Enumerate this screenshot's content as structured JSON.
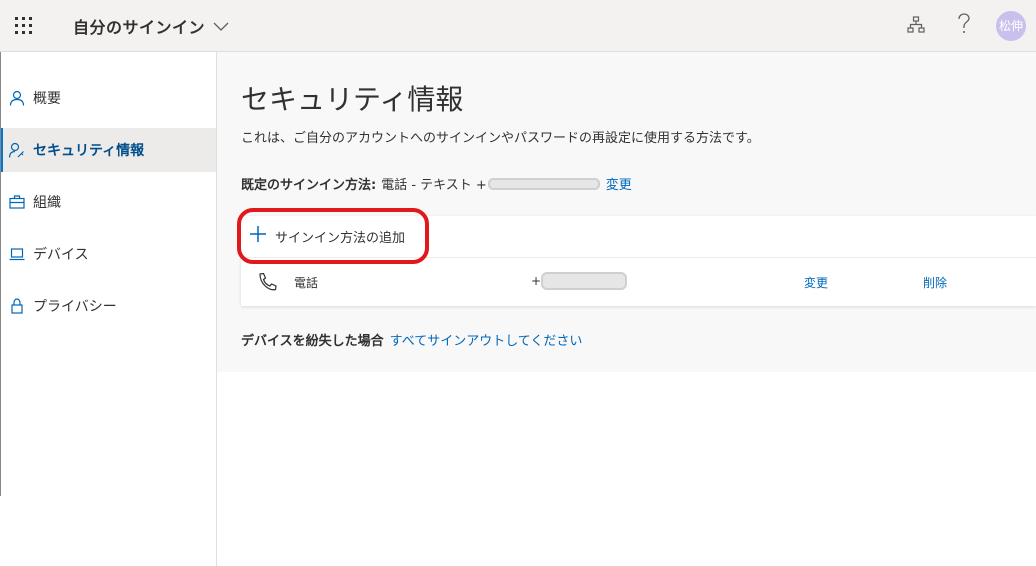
{
  "header": {
    "title": "自分のサインイン",
    "avatar_initials": "松伸",
    "icons": [
      "waffle-icon",
      "chevron-down-icon",
      "org-chart-icon",
      "help-icon"
    ]
  },
  "sidebar": {
    "items": [
      {
        "label": "概要",
        "icon": "person-icon",
        "active": false
      },
      {
        "label": "セキュリティ情報",
        "icon": "person-key-icon",
        "active": true
      },
      {
        "label": "組織",
        "icon": "briefcase-icon",
        "active": false
      },
      {
        "label": "デバイス",
        "icon": "laptop-icon",
        "active": false
      },
      {
        "label": "プライバシー",
        "icon": "lock-icon",
        "active": false
      }
    ]
  },
  "main": {
    "title": "セキュリティ情報",
    "description": "これは、ご自分のアカウントへのサインインやパスワードの再設定に使用する方法です。",
    "default_method_label": "既定のサインイン方法:",
    "default_method_value": "電話 - テキスト +",
    "default_method_change": "変更",
    "add_method_label": "サインイン方法の追加",
    "methods": [
      {
        "name": "電話",
        "value_prefix": "+",
        "change": "変更",
        "delete": "削除"
      }
    ],
    "lost_device_label": "デバイスを紛失した場合",
    "lost_device_link": "すべてサインアウトしてください"
  },
  "colors": {
    "accent": "#0078d4",
    "link": "#0067b8",
    "highlight_outline": "#e0191e",
    "avatar": "#c9c0ec"
  }
}
